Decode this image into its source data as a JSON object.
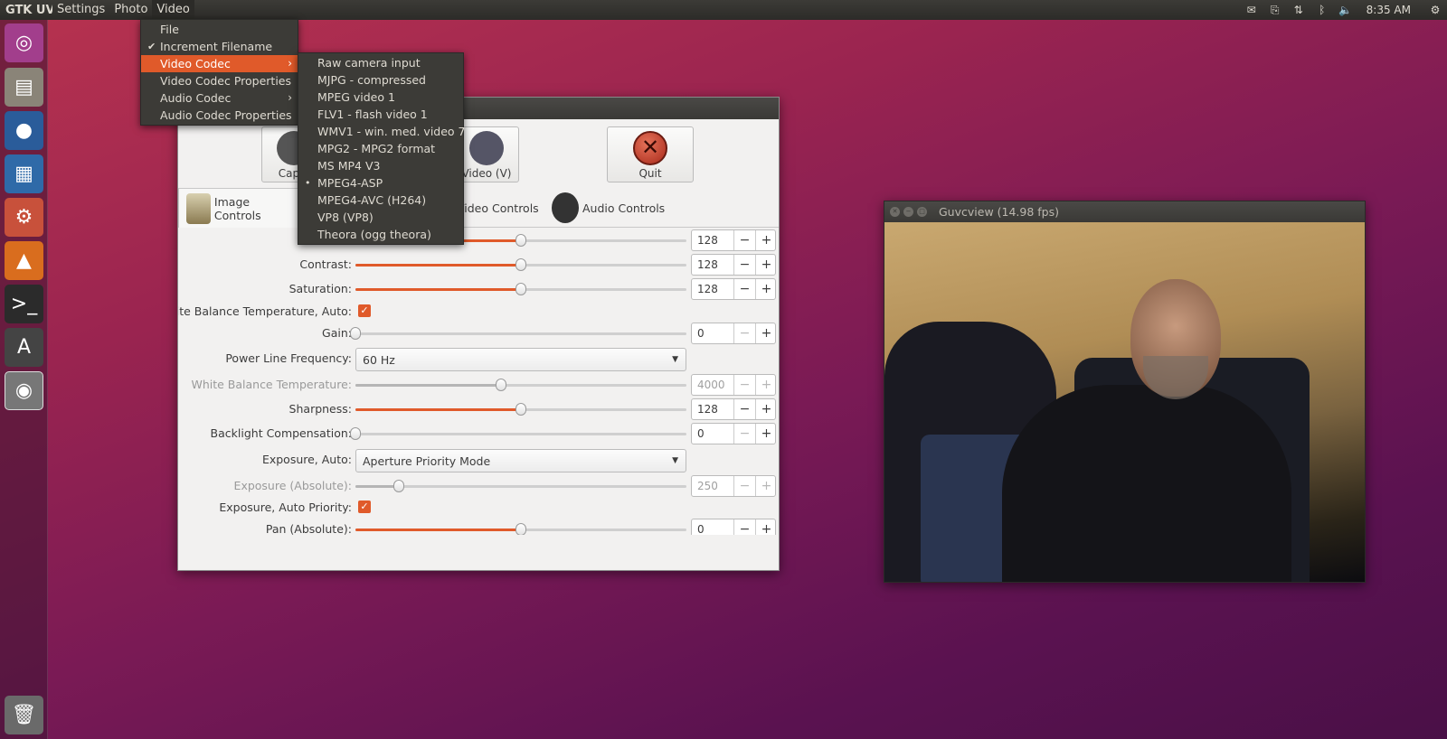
{
  "top_panel": {
    "app_title": "GTK UVC",
    "menus": [
      "Settings",
      "Photo",
      "Video"
    ],
    "clock": "8:35 AM"
  },
  "video_menu": {
    "items": [
      {
        "label": "File",
        "checked": false,
        "submenu": false
      },
      {
        "label": "Increment Filename",
        "checked": true,
        "submenu": false
      },
      {
        "label": "Video Codec",
        "checked": false,
        "submenu": true,
        "highlighted": true
      },
      {
        "label": "Video Codec Properties",
        "checked": false,
        "submenu": false
      },
      {
        "label": "Audio Codec",
        "checked": false,
        "submenu": true
      },
      {
        "label": "Audio Codec Properties",
        "checked": false,
        "submenu": false
      }
    ]
  },
  "codec_submenu": {
    "items": [
      "Raw camera input",
      "MJPG - compressed",
      "MPEG video 1",
      "FLV1 - flash video 1",
      "WMV1 - win. med. video 7",
      "MPG2 - MPG2 format",
      "MS MP4 V3",
      "MPEG4-ASP",
      "MPEG4-AVC (H264)",
      "VP8 (VP8)",
      "Theora (ogg theora)"
    ],
    "selected": "MPEG4-ASP"
  },
  "control_window": {
    "toolbar": {
      "cap_label": "Cap. I",
      "video_label": "Video (V)",
      "quit_label": "Quit"
    },
    "tabs": [
      "Image Controls",
      "Video Controls",
      "Audio Controls"
    ],
    "controls": {
      "contrast": {
        "label": "Contrast:",
        "value": "128",
        "level": 0.5
      },
      "brightness": {
        "value": "128",
        "level": 0.5
      },
      "saturation": {
        "label": "Saturation:",
        "value": "128",
        "level": 0.5
      },
      "wb_auto": {
        "label": "White Balance Temperature, Auto:",
        "checked": true
      },
      "gain": {
        "label": "Gain:",
        "value": "0",
        "level": 0.0
      },
      "power_line": {
        "label": "Power Line Frequency:",
        "value": "60 Hz"
      },
      "wb_temp": {
        "label": "White Balance Temperature:",
        "value": "4000",
        "level": 0.44,
        "disabled": true
      },
      "sharpness": {
        "label": "Sharpness:",
        "value": "128",
        "level": 0.5
      },
      "backlight": {
        "label": "Backlight Compensation:",
        "value": "0",
        "level": 0.0
      },
      "exposure_auto": {
        "label": "Exposure, Auto:",
        "value": "Aperture Priority Mode"
      },
      "exposure_abs": {
        "label": "Exposure (Absolute):",
        "value": "250",
        "level": 0.13,
        "disabled": true
      },
      "exposure_priority": {
        "label": "Exposure, Auto Priority:",
        "checked": true
      },
      "pan": {
        "label": "Pan (Absolute):",
        "value": "0",
        "level": 0.5
      }
    }
  },
  "preview_window": {
    "title": "Guvcview  (14.98 fps)"
  },
  "colors": {
    "accent": "#e05a2a",
    "panel": "#3c3b37"
  }
}
